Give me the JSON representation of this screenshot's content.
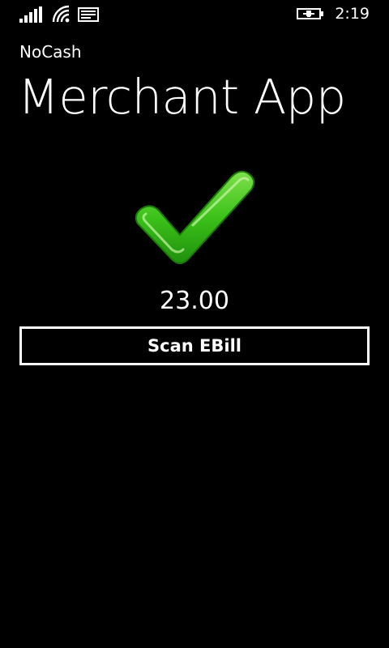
{
  "status_bar": {
    "time": "2:19",
    "icons": [
      "signal-strength-icon",
      "wifi-icon",
      "message-icon",
      "battery-charging-icon"
    ]
  },
  "app": {
    "name": "NoCash",
    "title": "Merchant App"
  },
  "payment": {
    "status_icon": "checkmark-icon",
    "status_color": "#3cc21a",
    "amount": "23.00"
  },
  "actions": {
    "scan_label": "Scan EBill"
  }
}
